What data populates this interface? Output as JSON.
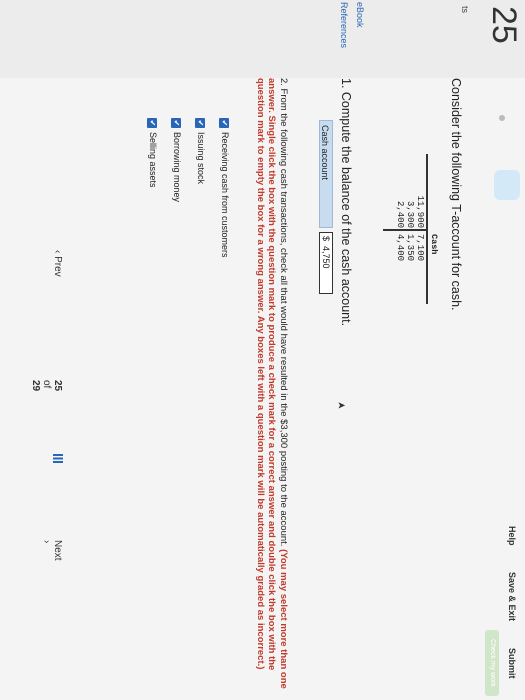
{
  "question_number": "25",
  "toolbar": {
    "help": "Help",
    "save": "Save & Exit",
    "submit": "Submit",
    "check": "Check my work"
  },
  "left_rail": {
    "item_ts": "ts",
    "ebook": "eBook",
    "references": "References"
  },
  "intro": "Consider the following T-account for cash.",
  "taccount": {
    "title": "Cash",
    "debits": [
      "11,900",
      "3,300",
      "2,400"
    ],
    "credits": [
      "7,100",
      "1,350",
      "4,400"
    ]
  },
  "q1": {
    "prompt": "1. Compute the balance of the cash account.",
    "row_label": "Cash account",
    "currency": "$",
    "answer": "4,750"
  },
  "q2": {
    "prompt_lead": "2. From the following cash transactions, check all that would have resulted in the $3,300 posting to the account.",
    "prompt_hint": "(You may select more than one answer. Single click the box with the question mark to produce a check mark for a correct answer and double click the box with the question mark to empty the box for a wrong answer. Any boxes left with a question mark will be automatically graded as incorrect.)",
    "choices": [
      {
        "label": "Receiving cash from customers",
        "checked": true
      },
      {
        "label": "Issuing stock",
        "checked": true
      },
      {
        "label": "Borrowing money",
        "checked": true
      },
      {
        "label": "Selling assets",
        "checked": true
      }
    ]
  },
  "nav": {
    "prev": "Prev",
    "current": "25",
    "of": "of",
    "total": "29",
    "next": "Next"
  }
}
